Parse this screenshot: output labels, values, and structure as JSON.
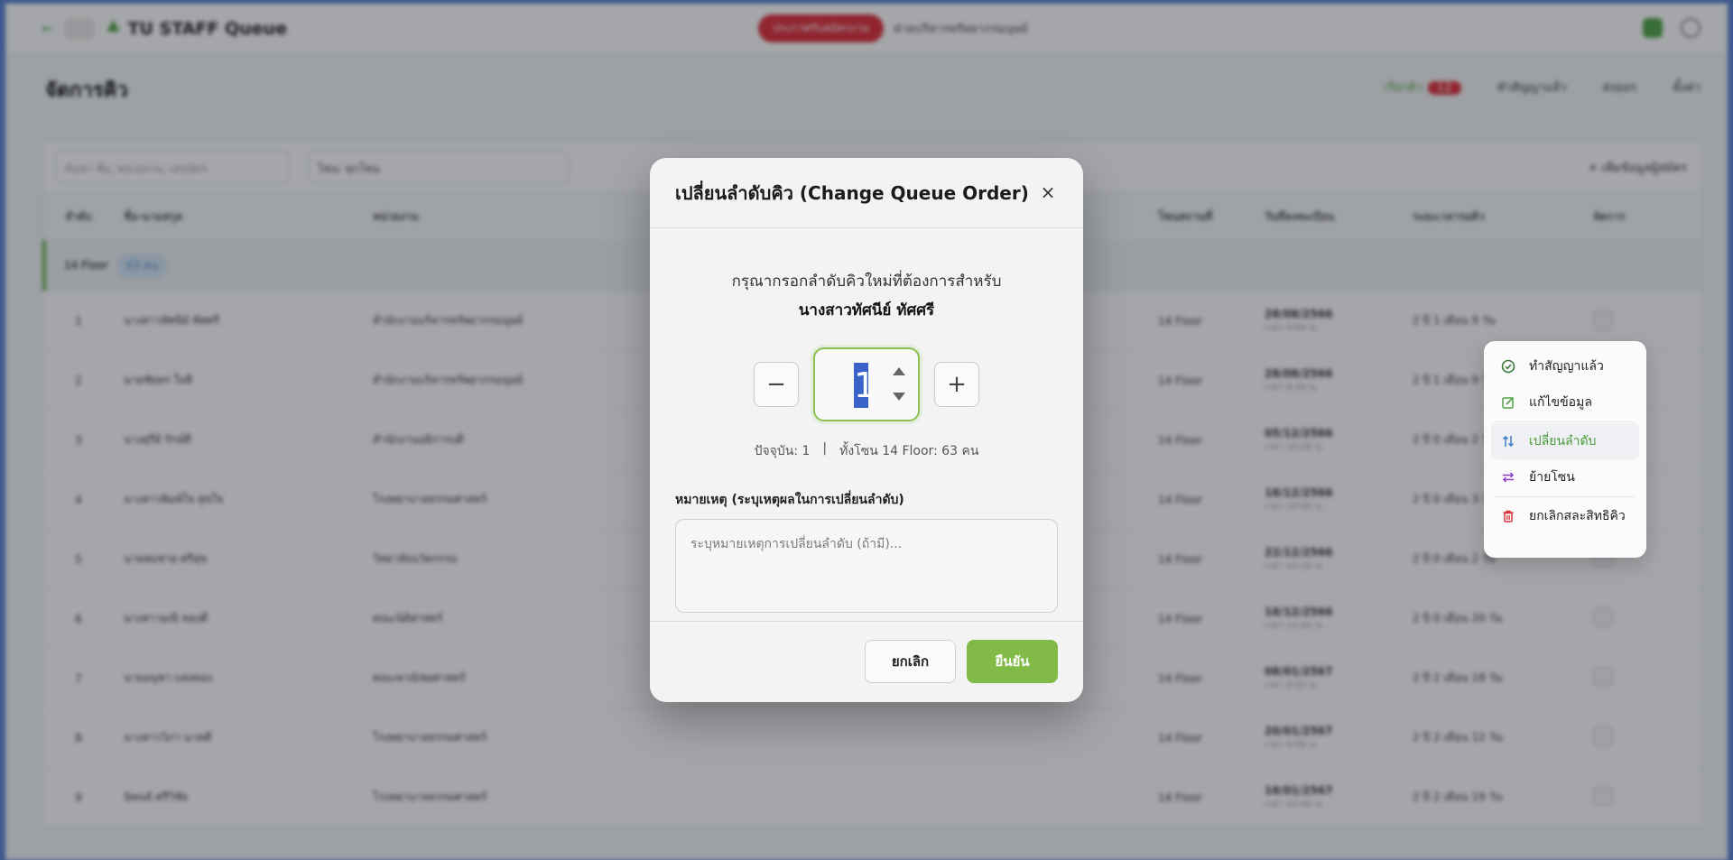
{
  "background": {
    "app_title": "TU STAFF Queue",
    "header_badge": "ประกาศรับสมัครงาน",
    "header_text": "ฝ่ายบริหารทรัพยากรมนุษย์",
    "page_title": "จัดการคิว",
    "actions": [
      "เรียกคิว",
      "ทำสัญญาแล้ว",
      "ส่งออก",
      "ตั้งค่า"
    ],
    "action_badge": "12",
    "search_placeholder": "ค้นหา ชื่อ, หน่วยงาน, เลขบัตร",
    "zone_label": "โซน:",
    "zone_value": "ทุกโซน",
    "add_button": "+ เพิ่มข้อมูลผู้สมัคร",
    "columns": [
      "ลำดับ",
      "ชื่อ-นามสกุล",
      "หน่วยงาน",
      "",
      "",
      "โซนสถานที่",
      "วันที่ลงทะเบียน",
      "ระยะเวลารอคิว",
      "จัดการ"
    ],
    "zone_group": "14 Floor",
    "zone_group_count": "63 คน",
    "rows": [
      {
        "no": "1",
        "name": "นางสาวทัศนีย์ ทัศศรี",
        "dept": "สำนักงานบริหารทรัพยากรมนุษย์",
        "phone": "",
        "id": "",
        "zone": "14 Floor",
        "date": "28/08/2566",
        "time": "เวลา 9:00 น.",
        "wait": "2 ปี 1 เดือน 9 วัน"
      },
      {
        "no": "2",
        "name": "นายชัยพร ใจดี",
        "dept": "สำนักงานบริหารทรัพยากรมนุษย์",
        "phone": "",
        "id": "",
        "zone": "14 Floor",
        "date": "28/08/2566",
        "time": "เวลา 9:30 น.",
        "wait": "2 ปี 1 เดือน 9 วัน"
      },
      {
        "no": "3",
        "name": "นางสุรีย์ รักษ์ดี",
        "dept": "สำนักงานอธิการบดี",
        "phone": "",
        "id": "",
        "zone": "14 Floor",
        "date": "05/12/2566",
        "time": "เวลา 10:00 น.",
        "wait": "2 ปี 0 เดือน 2 วัน"
      },
      {
        "no": "4",
        "name": "นางสาวพิมพ์ใจ สุขใจ",
        "dept": "โรงพยาบาลธรรมศาสตร์",
        "phone": "",
        "id": "",
        "zone": "14 Floor",
        "date": "18/12/2566",
        "time": "เวลา 10:00 น.",
        "wait": "2 ปี 0 เดือน 3 วัน"
      },
      {
        "no": "5",
        "name": "นายสมชาย ศรีสุข",
        "dept": "วิทยาลัยนวัตกรรม",
        "phone": "",
        "id": "",
        "zone": "14 Floor",
        "date": "22/12/2566",
        "time": "เวลา 10:30 น.",
        "wait": "2 ปี 0 เดือน 2 วัน"
      },
      {
        "no": "6",
        "name": "นางสาวมณี ทองดี",
        "dept": "คณะนิติศาสตร์",
        "phone": "",
        "id": "",
        "zone": "14 Floor",
        "date": "18/12/2566",
        "time": "เวลา 11:00 น.",
        "wait": "2 ปี 0 เดือน 20 วัน"
      },
      {
        "no": "7",
        "name": "นายอนุชา แสงทอง",
        "dept": "คณะพาณิชยศาสตร์",
        "phone": "",
        "id": "",
        "zone": "14 Floor",
        "date": "08/01/2567",
        "time": "เวลา 9:00 น.",
        "wait": "2 ปี 2 เดือน 18 วัน"
      },
      {
        "no": "8",
        "name": "นางสาววิภา นาคดี",
        "dept": "โรงพยาบาลธรรมศาสตร์",
        "phone": "",
        "id": "",
        "zone": "14 Floor",
        "date": "20/01/2567",
        "time": "เวลา 9:00 น.",
        "wait": "2 ปี 2 เดือน 12 วัน"
      },
      {
        "no": "9",
        "name": "นิพนธ์ ศรีวิชัย",
        "dept": "โรงพยาบาลธรรมศาสตร์",
        "phone": "",
        "id": "",
        "zone": "14 Floor",
        "date": "18/01/2567",
        "time": "เวลา 10:00 น.",
        "wait": "2 ปี 2 เดือน 19 วัน"
      }
    ]
  },
  "context_menu": {
    "items": [
      {
        "label": "ทำสัญญาแล้ว",
        "icon": "check-circle-icon",
        "color": "#3c7a3c"
      },
      {
        "label": "แก้ไขข้อมูล",
        "icon": "edit-icon",
        "color": "#52a548"
      },
      {
        "label": "เปลี่ยนลำดับ",
        "icon": "sort-arrows-icon",
        "color": "#3a7bc8"
      },
      {
        "label": "ย้ายโซน",
        "icon": "swap-icon",
        "color": "#8a3cc8"
      },
      {
        "label": "ยกเลิกสละสิทธิคิว",
        "icon": "trash-icon",
        "color": "#d9343a"
      }
    ]
  },
  "modal": {
    "title": "เปลี่ยนลำดับคิว (Change Queue Order)",
    "close_symbol": "×",
    "prompt": "กรุณากรอกลำดับคิวใหม่ที่ต้องการสำหรับ",
    "person_name": "นางสาวทัศนีย์ ทัศศรี",
    "decrement_symbol": "−",
    "increment_symbol": "+",
    "queue_value": "1",
    "current_text": "ปัจจุบัน: 1",
    "separator": "|",
    "zone_text": "ทั้งโซน 14 Floor: 63 คน",
    "reason_label": "หมายเหตุ (ระบุเหตุผลในการเปลี่ยนลำดับ)",
    "reason_placeholder": "ระบุหมายเหตุการเปลี่ยนลำดับ (ถ้ามี)...",
    "cancel_label": "ยกเลิก",
    "confirm_label": "ยืนยัน"
  },
  "colors": {
    "accent_green": "#82ba47",
    "selection_blue": "#3a63c9",
    "danger_red": "#d9343a"
  }
}
